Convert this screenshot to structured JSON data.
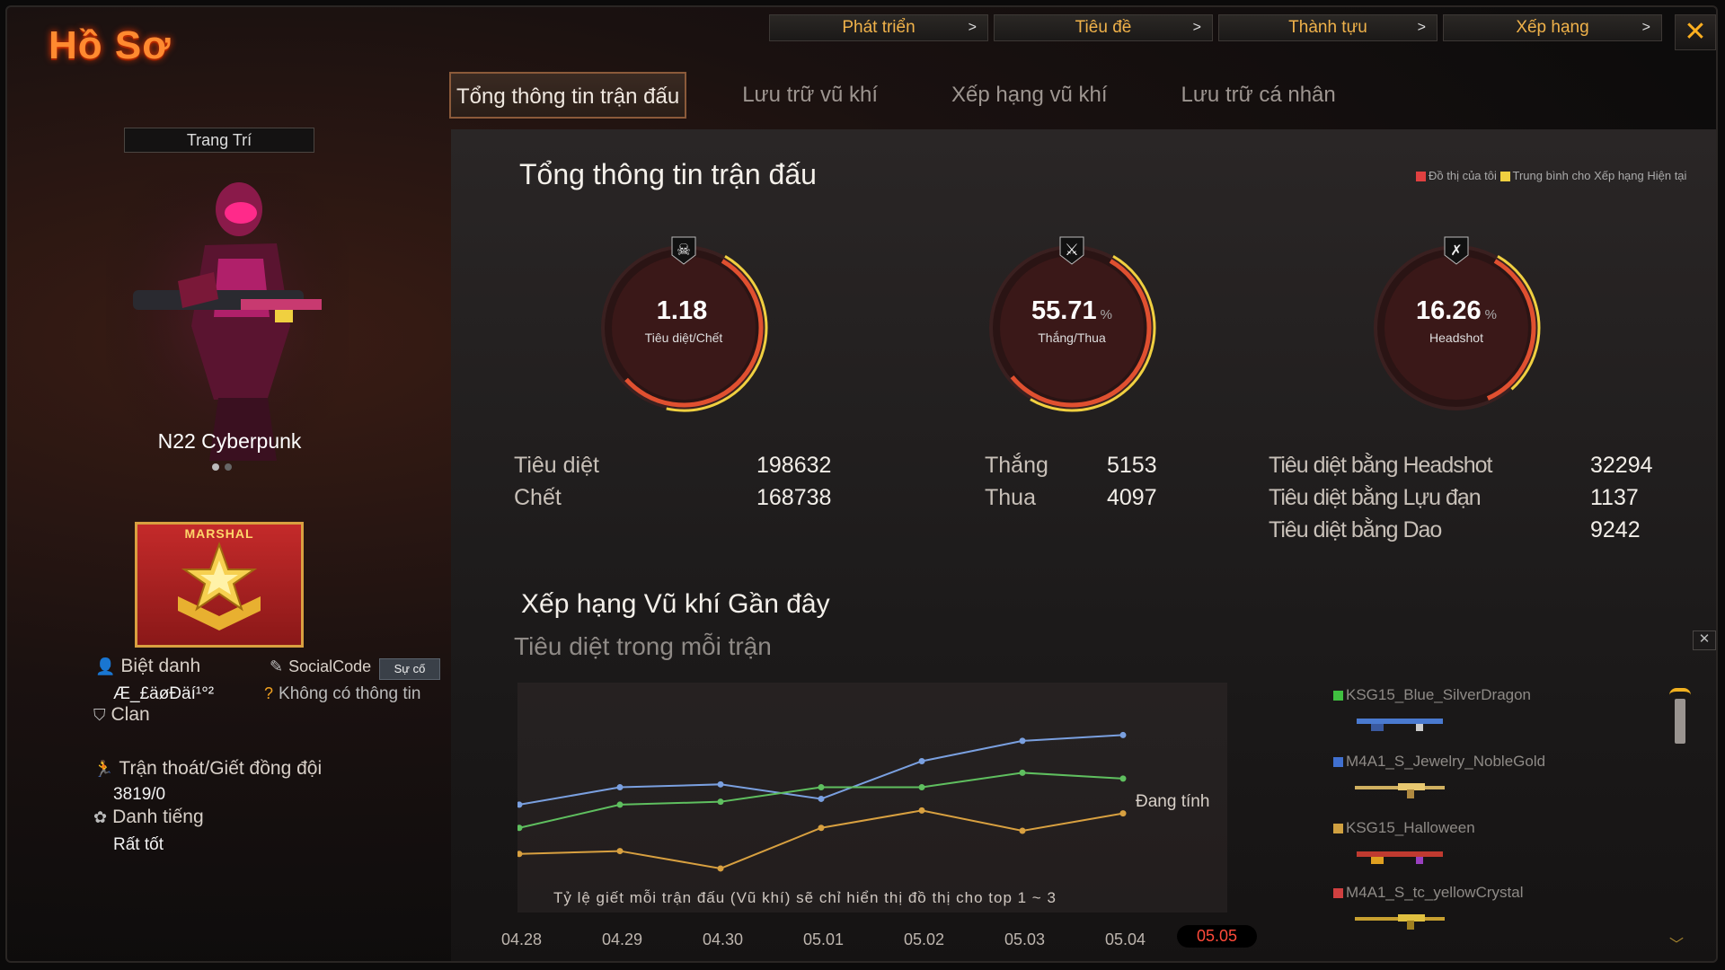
{
  "window": {
    "title": "Hồ Sơ",
    "close_icon": "close-icon"
  },
  "top_tabs": [
    {
      "label": "Phát triển"
    },
    {
      "label": "Tiêu đề"
    },
    {
      "label": "Thành tựu"
    },
    {
      "label": "Xếp hạng"
    }
  ],
  "main_tabs": [
    {
      "label": "Tổng thông tin trận đấu",
      "active": true
    },
    {
      "label": "Lưu trữ vũ khí",
      "active": false
    },
    {
      "label": "Xếp hạng vũ khí",
      "active": false
    },
    {
      "label": "Lưu trữ cá nhân",
      "active": false
    }
  ],
  "profile": {
    "decor_label": "Trang Trí",
    "character_name": "N22 Cyberpunk",
    "rank_text": "MARSHAL",
    "nickname_label": "Biệt danh",
    "nickname_value": "Æ_£äøÐäí¹°²",
    "socialcode_label": "SocialCode",
    "socialcode_badge": "Sự cố",
    "socialcode_value": "Không có thông tin",
    "clan_label": "Clan",
    "escape_label": "Trận thoát/Giết đồng đội",
    "escape_value": "3819/0",
    "reputation_label": "Danh tiếng",
    "reputation_value": "Rất tốt"
  },
  "summary": {
    "heading": "Tổng thông tin trận đấu",
    "legend": {
      "mine": "Đồ thị của tôi",
      "average": "Trung bình cho Xếp hạng Hiện tại",
      "mine_color": "#e04040",
      "average_color": "#f0d040"
    },
    "gauges": [
      {
        "value": "1.18",
        "unit": "",
        "label": "Tiêu diệt/Chết",
        "icon": "skull-icon",
        "fill": 0.55,
        "avg_fill": 0.45
      },
      {
        "value": "55.71",
        "unit": "%",
        "label": "Thắng/Thua",
        "icon": "crossed-swords-icon",
        "fill": 0.5571,
        "avg_fill": 0.5
      },
      {
        "value": "16.26",
        "unit": "%",
        "label": "Headshot",
        "icon": "crossed-guns-icon",
        "fill": 0.35,
        "avg_fill": 0.3
      }
    ],
    "kd": [
      {
        "label": "Tiêu diệt",
        "value": "198632"
      },
      {
        "label": "Chết",
        "value": "168738"
      }
    ],
    "wl": [
      {
        "label": "Thắng",
        "value": "5153"
      },
      {
        "label": "Thua",
        "value": "4097"
      }
    ],
    "special": [
      {
        "label": "Tiêu diệt bằng Headshot",
        "value": "32294"
      },
      {
        "label": "Tiêu diệt bằng Lựu đạn",
        "value": "1137"
      },
      {
        "label": "Tiêu diệt bằng Dao",
        "value": "9242"
      }
    ]
  },
  "weapon_rank": {
    "heading": "Xếp hạng Vũ khí Gần đây",
    "pending": "Đang tính",
    "note": "Tỷ lệ giết mỗi trận đấu (Vũ khí) sẽ chỉ hiển thị đồ thị cho top 1 ~ 3",
    "weapons": [
      {
        "name": "KSG15_Blue_SilverDragon",
        "color": "#40c040"
      },
      {
        "name": "M4A1_S_Jewelry_NobleGold",
        "color": "#4070d0"
      },
      {
        "name": "KSG15_Halloween",
        "color": "#d0a040"
      },
      {
        "name": "M4A1_S_tc_yellowCrystal",
        "color": "#d04040"
      }
    ]
  },
  "chart_data": {
    "type": "line",
    "title": "Tiêu diệt trong mỗi trận",
    "x": [
      "04.28",
      "04.29",
      "04.30",
      "05.01",
      "05.02",
      "05.03",
      "05.04",
      "05.05"
    ],
    "selected_x": "05.05",
    "series": [
      {
        "color": "#7aa0e0",
        "values": [
          15.5,
          18.5,
          19.0,
          16.5,
          23.0,
          26.5,
          27.5
        ]
      },
      {
        "color": "#5fbf5f",
        "values": [
          11.5,
          15.5,
          16.0,
          18.5,
          18.5,
          21.0,
          20.0
        ]
      },
      {
        "color": "#d8a040",
        "values": [
          7.0,
          7.5,
          4.5,
          11.5,
          14.5,
          11.0,
          14.0
        ]
      }
    ],
    "ylim": [
      0,
      35
    ],
    "grid": false
  }
}
